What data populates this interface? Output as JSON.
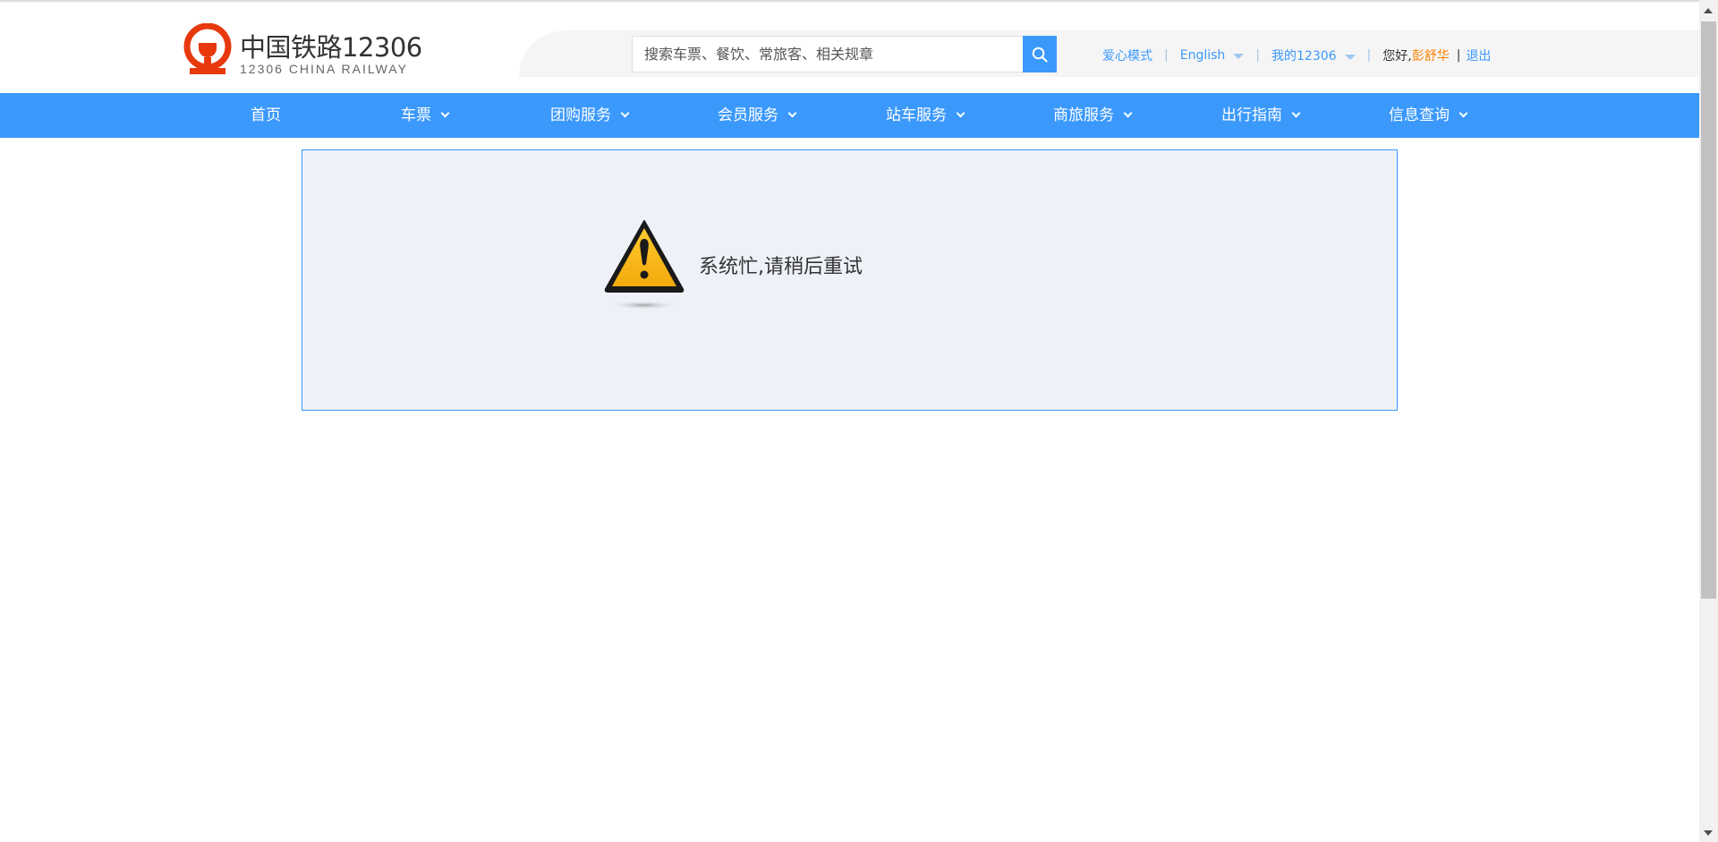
{
  "header": {
    "logo_cn": "中国铁路12306",
    "logo_en": "12306 CHINA RAILWAY",
    "search_placeholder": "搜索车票、餐饮、常旅客、相关规章",
    "links": {
      "care_mode": "爱心模式",
      "language": "English",
      "my_account": "我的12306",
      "greeting": "您好,",
      "username": "彭舒华",
      "separator": "|",
      "logout": "退出"
    }
  },
  "nav": {
    "items": [
      {
        "label": "首页"
      },
      {
        "label": "车票"
      },
      {
        "label": "团购服务"
      },
      {
        "label": "会员服务"
      },
      {
        "label": "站车服务"
      },
      {
        "label": "商旅服务"
      },
      {
        "label": "出行指南"
      },
      {
        "label": "信息查询"
      }
    ]
  },
  "error": {
    "message": "系统忙,请稍后重试",
    "icon": "warning-icon"
  },
  "colors": {
    "brand_blue": "#3b99fc",
    "logo_red": "#e8380d",
    "username_orange": "#fc8302",
    "panel_bg": "#eef1f8",
    "warning_yellow": "#f9b50f"
  }
}
